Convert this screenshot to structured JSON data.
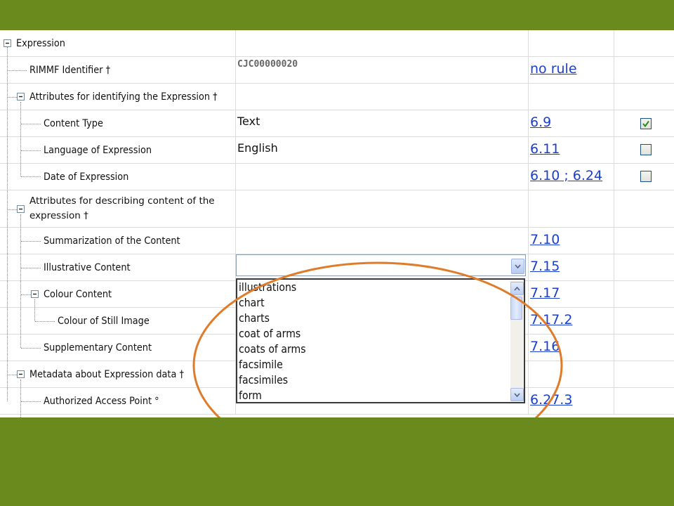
{
  "rows": {
    "r0": {
      "label": "Expression"
    },
    "r1": {
      "label": "RIMMF Identifier †",
      "value": "CJC00000020",
      "rule": "no rule"
    },
    "r2": {
      "label": "Attributes for identifying the Expression †"
    },
    "r3": {
      "label": "Content Type",
      "value": "Text",
      "rule": "6.9",
      "checked": true
    },
    "r4": {
      "label": "Language of Expression",
      "value": "English",
      "rule": "6.11",
      "checked": false
    },
    "r5": {
      "label": "Date of Expression",
      "rule": "6.10 ; 6.24",
      "checked": false
    },
    "r6": {
      "label": "Attributes for describing content of the expression †"
    },
    "r7": {
      "label": "Summarization of the Content",
      "rule": "7.10"
    },
    "r8": {
      "label": "Illustrative Content",
      "rule": "7.15"
    },
    "r9": {
      "label": "Colour Content",
      "rule": "7.17"
    },
    "r10": {
      "label": "Colour of Still Image",
      "rule": "7.17.2"
    },
    "r11": {
      "label": "Supplementary Content",
      "rule": "7.16"
    },
    "r12": {
      "label": "Metadata about Expression data †"
    },
    "r13": {
      "label": "Authorized Access Point °",
      "rule": "6.27.3"
    }
  },
  "dropdown": {
    "options": [
      "illustrations",
      "chart",
      "charts",
      "coat of arms",
      "coats of arms",
      "facsimile",
      "facsimiles",
      "form"
    ]
  },
  "colors": {
    "background_green": "#6a8a1e",
    "highlight_ellipse": "#e07b2a",
    "link_blue": "#1a3fd0",
    "checkmark_green": "#2a8a1a"
  },
  "icons": {
    "expand": "minus-box-icon",
    "checked": "checkbox-checked-icon",
    "unchecked": "checkbox-unchecked-icon",
    "dropdown": "chevron-down-icon",
    "scroll_up": "scroll-up-icon",
    "scroll_down": "scroll-down-icon"
  }
}
